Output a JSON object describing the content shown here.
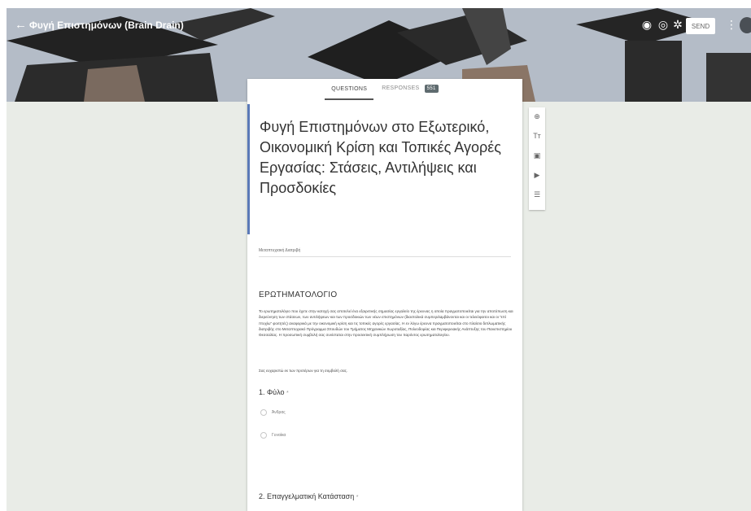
{
  "topbar": {
    "form_name": "Φυγή Επιστημόνων (Brain Drain)",
    "send_label": "SEND"
  },
  "tabs": {
    "questions": "QUESTIONS",
    "responses": "RESPONSES",
    "responses_count": "551"
  },
  "form": {
    "title": "Φυγή Επιστημόνων στο Εξωτερικό, Οικονομική Κρίση και Τοπικές Αγορές Εργασίας: Στάσεις, Αντιλήψεις και Προσδοκίες",
    "description": "Μεταπτυχιακή Διατριβή"
  },
  "section": {
    "title": "ΕΡΩΤΗΜΑΤΟΛΟΓΙΟ",
    "body": "Το ερωτηματολόγιο που έχετε στην κατοχή σας αποτελεί ένα εξαιρετικής σημασίας εργαλείο της έρευνας η οποία πραγματοποιείται για την αποτύπωση και διερεύνηση των στάσεων, των αντιλήψεων και των προσδοκιών των νέων επιστημόνων (διαστολικά συμπεριλαμβάνονται και οι τελειόφοιτοι και οι \"επί πτυχίω\" φοιτητές) αναφορικά με την οικονομική κρίση και τις τοπικές αγορές εργασίας. Η εν λόγω έρευνα πραγματοποιείται στο πλαίσιο διπλωματικής διατριβής στο Μεταπτυχιακό Πρόγραμμα Σπουδών του Τμήματος Μηχανικών Χωροταξίας, Πολεοδομίας και Περιφερειακής Ανάπτυξης του Πανεπιστημίου Θεσσαλίας. Η προσωπική συμβολή σας συνίσταται στην προσεκτική συμπλήρωση του παρόντος ερωτηματολογίου.",
    "thanks": "Σας ευχαριστώ εκ των προτέρων για τη συμβολή σας."
  },
  "questions": [
    {
      "title": "1. Φύλο",
      "required_mark": "*",
      "options": [
        "Άνδρας",
        "Γυναίκα"
      ]
    },
    {
      "title": "2. Επαγγελματική Κατάσταση",
      "required_mark": "*"
    }
  ],
  "icons": {
    "topbar": [
      "palette-icon",
      "preview-icon",
      "settings-icon",
      "more-vert-icon"
    ],
    "side": [
      "add-question-icon",
      "title-text-icon",
      "image-icon",
      "video-icon",
      "section-icon"
    ]
  },
  "colors": {
    "accent": "#5b7ab8",
    "page_bg": "#e9ece7",
    "badge": "#5f6b6f"
  }
}
